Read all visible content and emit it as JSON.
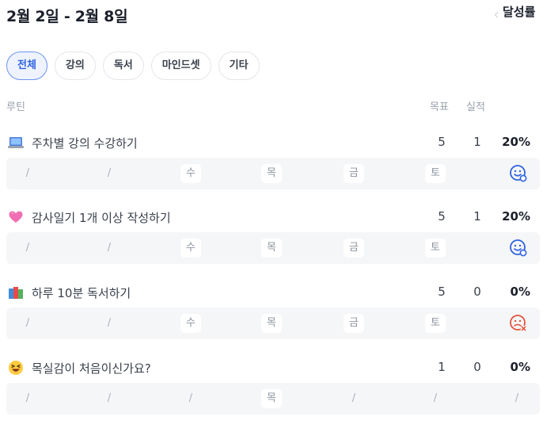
{
  "header": {
    "title": "2월 2일 - 2월 8일",
    "prev_icon": "chevron-left-icon",
    "next_icon": "chevron-right-icon"
  },
  "tabs": [
    {
      "label": "전체",
      "active": true
    },
    {
      "label": "강의",
      "active": false
    },
    {
      "label": "독서",
      "active": false
    },
    {
      "label": "마인드셋",
      "active": false
    },
    {
      "label": "기타",
      "active": false
    }
  ],
  "columns": {
    "routine": "루틴",
    "goal": "목표",
    "actual": "실적",
    "rate": "달성률"
  },
  "routines": [
    {
      "emoji": "laptop-emoji",
      "name": "주차별 강의 수강하기",
      "goal": "5",
      "actual": "1",
      "rate": "20%",
      "days": [
        "/",
        "/",
        "수",
        "목",
        "금",
        "토"
      ],
      "status": "smile-icon",
      "status_color": "#2f63e0"
    },
    {
      "emoji": "heart-emoji",
      "name": "감사일기 1개 이상 작성하기",
      "goal": "5",
      "actual": "1",
      "rate": "20%",
      "days": [
        "/",
        "/",
        "수",
        "목",
        "금",
        "토"
      ],
      "status": "smile-icon",
      "status_color": "#2f63e0"
    },
    {
      "emoji": "books-emoji",
      "name": "하루 10분 독서하기",
      "goal": "5",
      "actual": "0",
      "rate": "0%",
      "days": [
        "/",
        "/",
        "수",
        "목",
        "금",
        "토"
      ],
      "status": "sad-icon",
      "status_color": "#e5533d"
    },
    {
      "emoji": "grin-squint-emoji",
      "name": "목실감이 처음이신가요?",
      "goal": "1",
      "actual": "0",
      "rate": "0%",
      "days": [
        "/",
        "/",
        "/",
        "목",
        "/",
        "/",
        "/"
      ],
      "status": "",
      "status_color": ""
    }
  ]
}
